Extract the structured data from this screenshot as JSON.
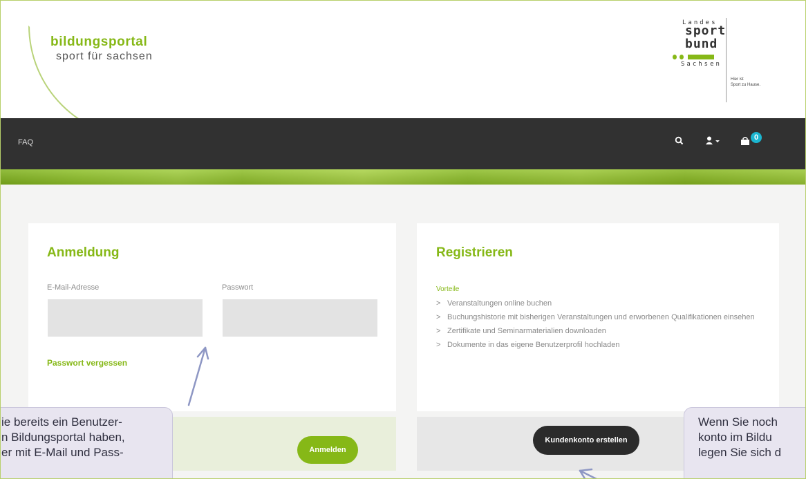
{
  "header": {
    "logo_title": "bildungsportal",
    "logo_subtitle": "sport für sachsen",
    "partner_logo": {
      "line1": "Landes",
      "line2": "sport",
      "line3": "bund",
      "line4": "Sachsen",
      "slogan": "Hier ist\nSport zu Hause."
    }
  },
  "navbar": {
    "faq_label": "FAQ",
    "search_icon": "search-icon",
    "user_icon": "user-dropdown-icon",
    "cart_icon": "cart-icon",
    "cart_count": "0",
    "accent_color": "#1bb6d0"
  },
  "login": {
    "title": "Anmeldung",
    "email_label": "E-Mail-Adresse",
    "email_value": "",
    "password_label": "Passwort",
    "password_value": "",
    "forgot_label": "Passwort vergessen",
    "submit_label": "Anmelden"
  },
  "register": {
    "title": "Registrieren",
    "subtitle": "Vorteile",
    "benefits": [
      "Veranstaltungen online buchen",
      "Buchungshistorie mit bisherigen Veranstaltungen und erworbenen Qualifikationen einsehen",
      "Zertifikate und Seminarmaterialien downloaden",
      "Dokumente in das eigene Benutzerprofil hochladen"
    ],
    "submit_label": "Kundenkonto erstellen"
  },
  "callouts": {
    "left": "ie bereits ein Benutzer-\nn Bildungsportal haben,\ner mit E-Mail und Pass-",
    "right": "Wenn Sie noch\nkonto im Bildu\nlegen Sie sich d"
  },
  "colors": {
    "brand_green": "#86b817",
    "nav_dark": "#313131",
    "callout_bg": "#e8e5f0"
  }
}
